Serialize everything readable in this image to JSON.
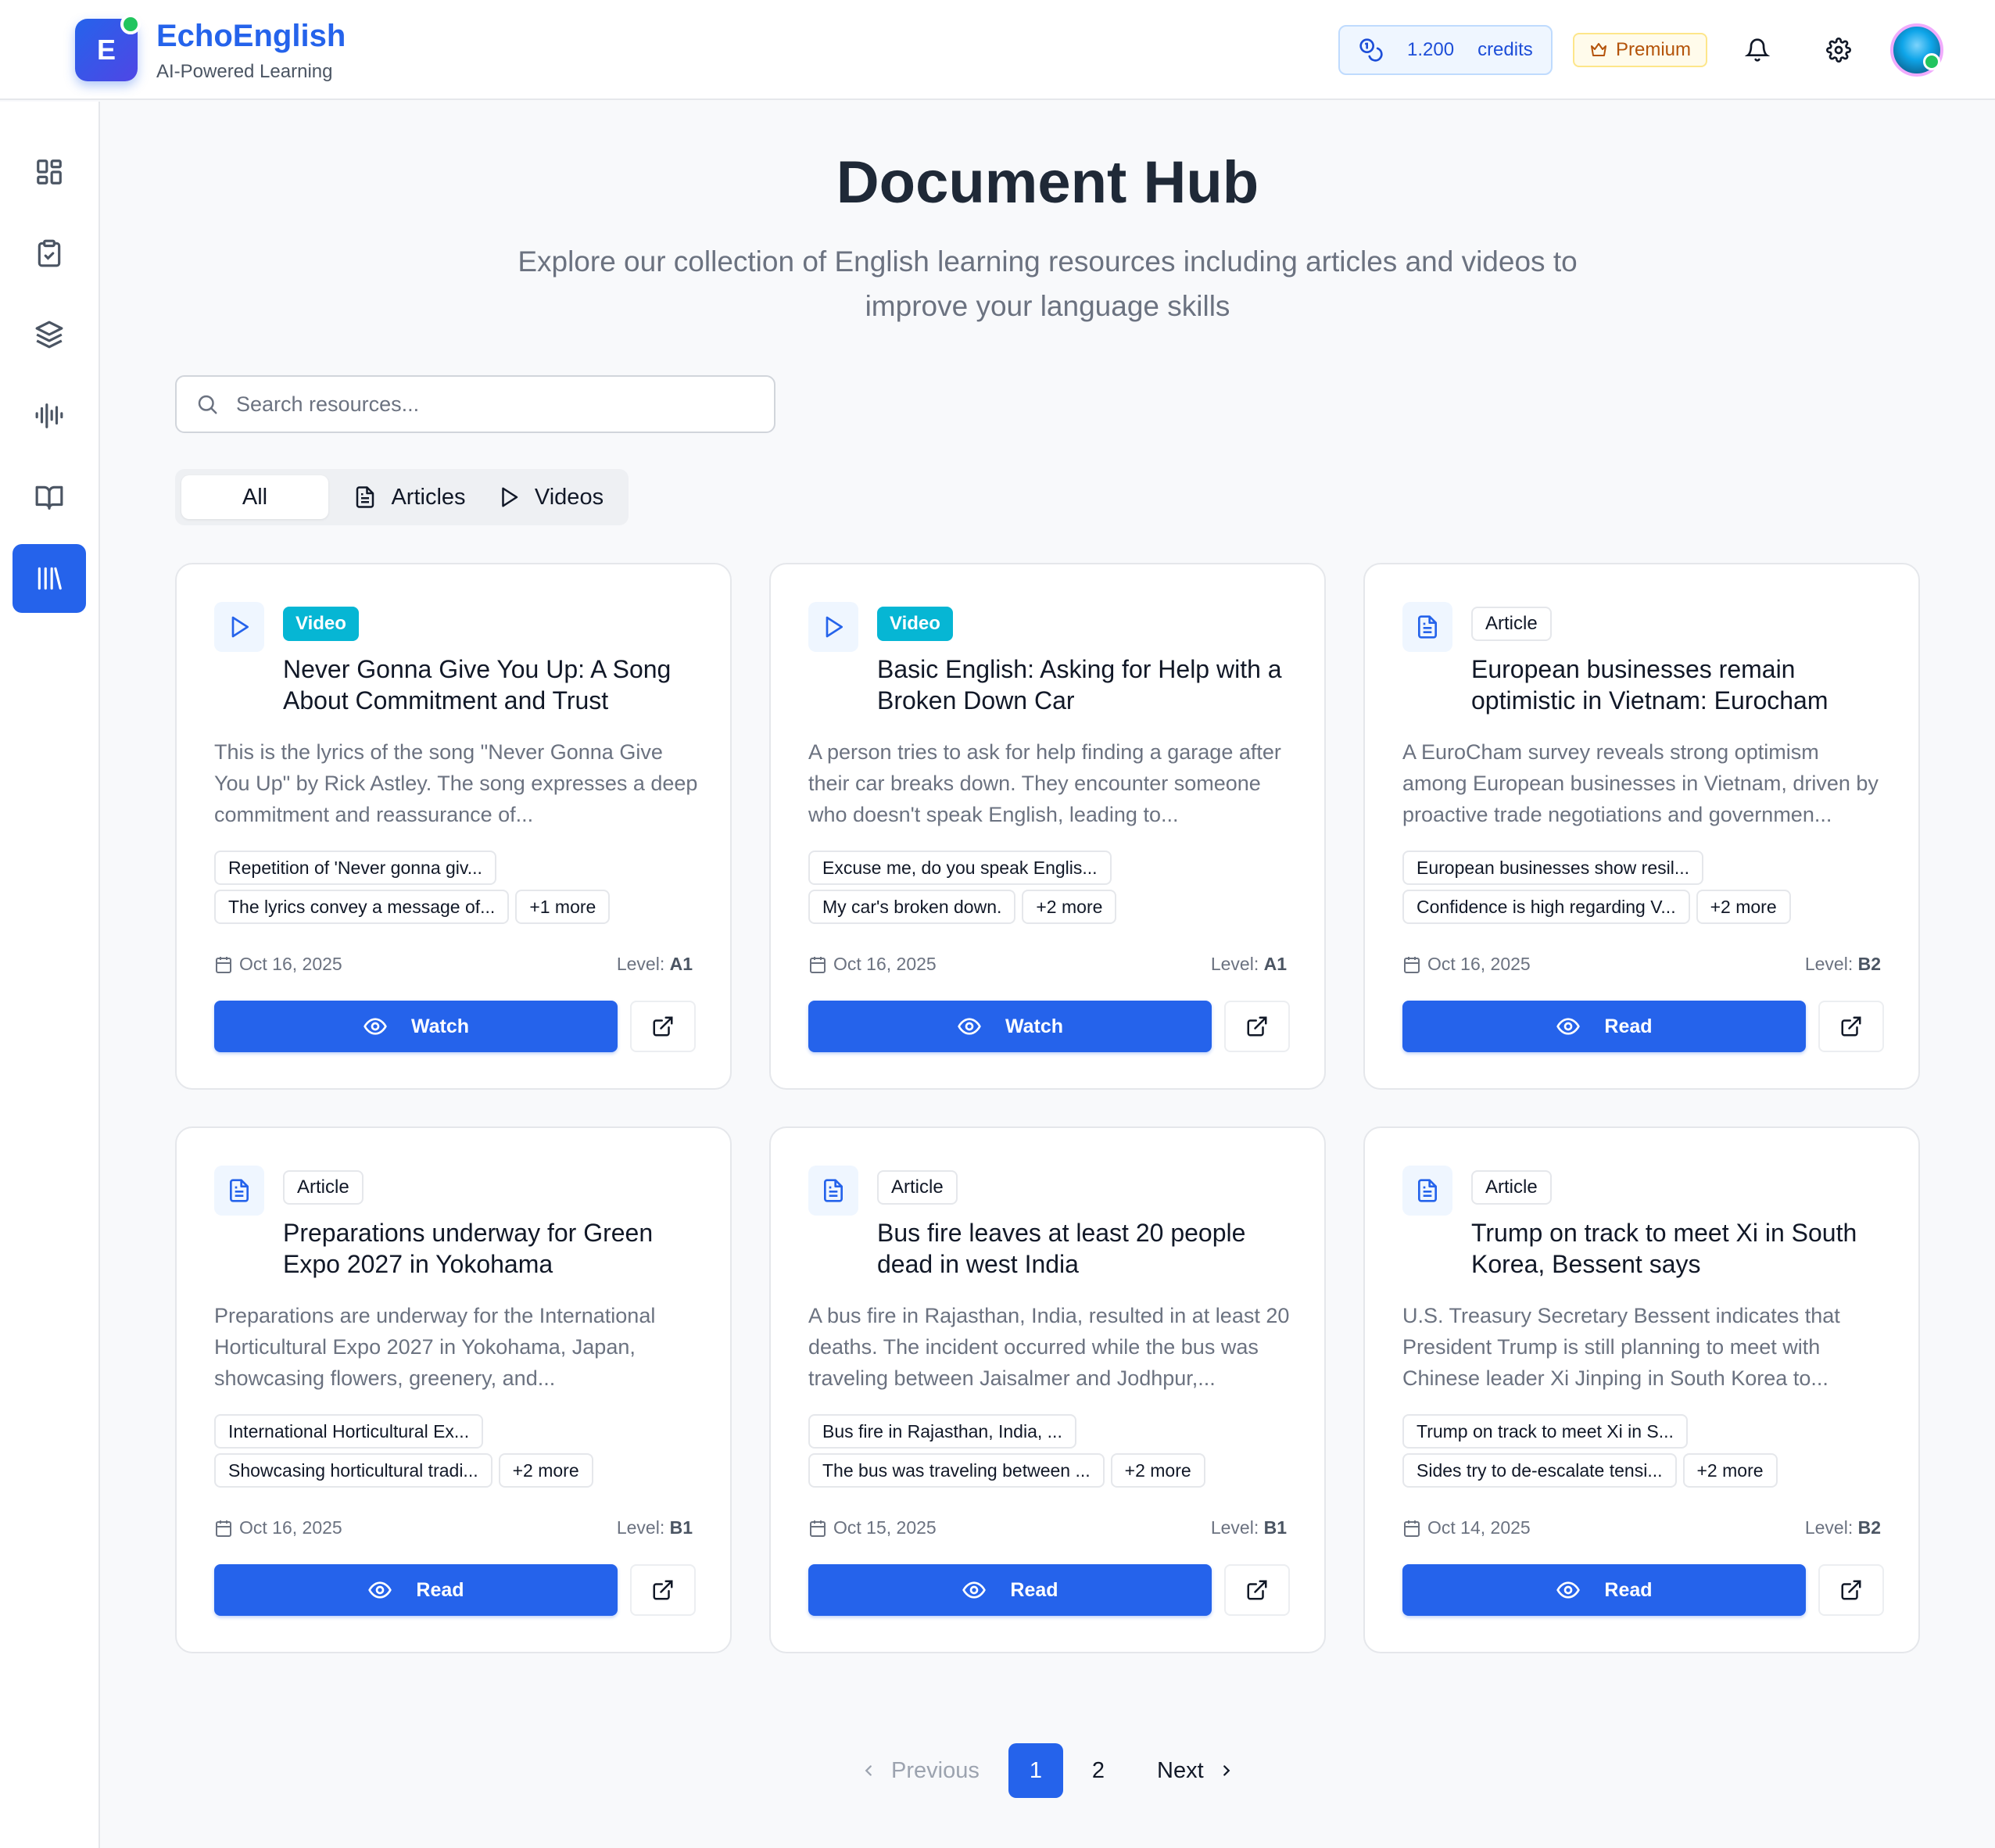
{
  "app": {
    "logo_letter": "E",
    "name": "EchoEnglish",
    "tagline": "AI-Powered Learning"
  },
  "header": {
    "credits_value": "1.200",
    "credits_label": "credits",
    "premium_label": "Premium"
  },
  "page": {
    "title": "Document Hub",
    "subtitle": "Explore our collection of English learning resources including articles and videos to improve your language skills"
  },
  "search": {
    "placeholder": "Search resources...",
    "value": ""
  },
  "tabs": [
    {
      "label": "All",
      "active": true
    },
    {
      "label": "Articles",
      "icon": "document-icon"
    },
    {
      "label": "Videos",
      "icon": "play-icon"
    }
  ],
  "cards": [
    {
      "type": "Video",
      "title": "Never Gonna Give You Up: A Song About Commitment and Trust",
      "description": "This is the lyrics of the song \"Never Gonna Give You Up\" by Rick Astley. The song expresses a deep commitment and reassurance of...",
      "tag1": "Repetition of 'Never gonna giv...",
      "tag2": "The lyrics convey a message of...",
      "more": "+1 more",
      "date": "Oct 16, 2025",
      "level_label": "Level:",
      "level": "A1",
      "action": "Watch"
    },
    {
      "type": "Video",
      "title": "Basic English: Asking for Help with a Broken Down Car",
      "description": "A person tries to ask for help finding a garage after their car breaks down. They encounter someone who doesn't speak English, leading to...",
      "tag1": "Excuse me, do you speak Englis...",
      "tag2": "My car's broken down.",
      "more": "+2 more",
      "date": "Oct 16, 2025",
      "level_label": "Level:",
      "level": "A1",
      "action": "Watch"
    },
    {
      "type": "Article",
      "title": "European businesses remain optimistic in Vietnam: Eurocham",
      "description": "A EuroCham survey reveals strong optimism among European businesses in Vietnam, driven by proactive trade negotiations and governmen...",
      "tag1": "European businesses show resil...",
      "tag2": "Confidence is high regarding V...",
      "more": "+2 more",
      "date": "Oct 16, 2025",
      "level_label": "Level:",
      "level": "B2",
      "action": "Read"
    },
    {
      "type": "Article",
      "title": "Preparations underway for Green Expo 2027 in Yokohama",
      "description": "Preparations are underway for the International Horticultural Expo 2027 in Yokohama, Japan, showcasing flowers, greenery, and...",
      "tag1": "International Horticultural Ex...",
      "tag2": "Showcasing horticultural tradi...",
      "more": "+2 more",
      "date": "Oct 16, 2025",
      "level_label": "Level:",
      "level": "B1",
      "action": "Read"
    },
    {
      "type": "Article",
      "title": "Bus fire leaves at least 20 people dead in west India",
      "description": "A bus fire in Rajasthan, India, resulted in at least 20 deaths. The incident occurred while the bus was traveling between Jaisalmer and Jodhpur,...",
      "tag1": "Bus fire in Rajasthan, India, ...",
      "tag2": "The bus was traveling between ...",
      "more": "+2 more",
      "date": "Oct 15, 2025",
      "level_label": "Level:",
      "level": "B1",
      "action": "Read"
    },
    {
      "type": "Article",
      "title": "Trump on track to meet Xi in South Korea, Bessent says",
      "description": "U.S. Treasury Secretary Bessent indicates that President Trump is still planning to meet with Chinese leader Xi Jinping in South Korea to...",
      "tag1": "Trump on track to meet Xi in S...",
      "tag2": "Sides try to de-escalate tensi...",
      "more": "+2 more",
      "date": "Oct 14, 2025",
      "level_label": "Level:",
      "level": "B2",
      "action": "Read"
    }
  ],
  "pagination": {
    "previous": "Previous",
    "page1": "1",
    "page2": "2",
    "next": "Next",
    "current": 1
  },
  "sidebar": [
    {
      "icon": "dashboard-icon"
    },
    {
      "icon": "clipboard-check-icon"
    },
    {
      "icon": "layers-icon"
    },
    {
      "icon": "audio-wave-icon"
    },
    {
      "icon": "book-open-icon"
    },
    {
      "icon": "library-icon",
      "active": true
    }
  ],
  "colors": {
    "primary": "#2563eb",
    "video_badge": "#06b6d4",
    "premium": "#b45309",
    "online": "#22c55e"
  }
}
